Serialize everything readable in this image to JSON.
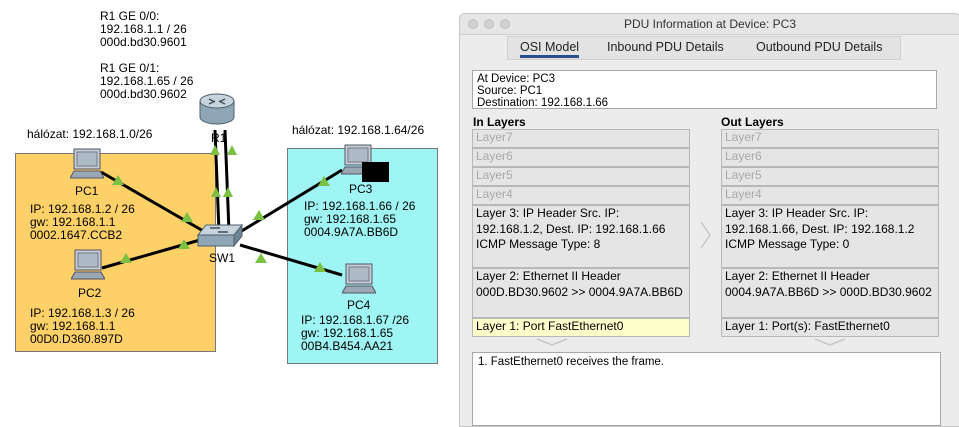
{
  "topology": {
    "r1_info": "R1 GE 0/0:\n192.168.1.1 / 26\n000d.bd30.9601\n\nR1 GE 0/1:\n192.168.1.65 / 26\n000d.bd30.9602",
    "net_left_label": "hálózat: 192.168.1.0/26",
    "net_right_label": "hálózat: 192.168.1.64/26",
    "router_label": "R1",
    "switch_label": "SW1",
    "pc1": {
      "label": "PC1",
      "info": "IP: 192.168.1.2 / 26\ngw: 192.168.1.1\n0002.1647.CCB2"
    },
    "pc2": {
      "label": "PC2",
      "info": "IP: 192.168.1.3 / 26\ngw: 192.168.1.1\n00D0.D360.897D"
    },
    "pc3": {
      "label": "PC3",
      "info": "IP: 192.168.1.66 / 26\ngw: 192.168.1.65\n0004.9A7A.BB6D"
    },
    "pc4": {
      "label": "PC4",
      "info": "IP: 192.168.1.67 /26\ngw: 192.168.1.65\n00B4.B454.AA21"
    },
    "colors": {
      "left_net": "#fdd167",
      "right_net": "#9ff5f3",
      "link_triangle": "#7bc043"
    },
    "icons": [
      "router-icon",
      "switch-icon",
      "pc-icon"
    ]
  },
  "pdu": {
    "window_title": "PDU Information at Device: PC3",
    "tabs": [
      "OSI Model",
      "Inbound PDU Details",
      "Outbound PDU Details"
    ],
    "active_tab": "OSI Model",
    "info": [
      "At Device: PC3",
      "Source: PC1",
      "Destination: 192.168.1.66"
    ],
    "in_layers_title": "In Layers",
    "out_layers_title": "Out Layers",
    "in_layers": [
      "Layer7",
      "Layer6",
      "Layer5",
      "Layer4",
      "Layer 3: IP Header Src. IP: 192.168.1.2, Dest. IP: 192.168.1.66 ICMP Message Type: 8",
      "Layer 2: Ethernet II Header 000D.BD30.9602 >> 0004.9A7A.BB6D",
      "Layer 1: Port FastEthernet0"
    ],
    "out_layers": [
      "Layer7",
      "Layer6",
      "Layer5",
      "Layer4",
      "Layer 3: IP Header Src. IP: 192.168.1.66, Dest. IP: 192.168.1.2 ICMP Message Type: 0",
      "Layer 2: Ethernet II Header 0004.9A7A.BB6D >> 000D.BD30.9602",
      "Layer 1: Port(s): FastEthernet0"
    ],
    "message": "1. FastEthernet0 receives the frame."
  }
}
